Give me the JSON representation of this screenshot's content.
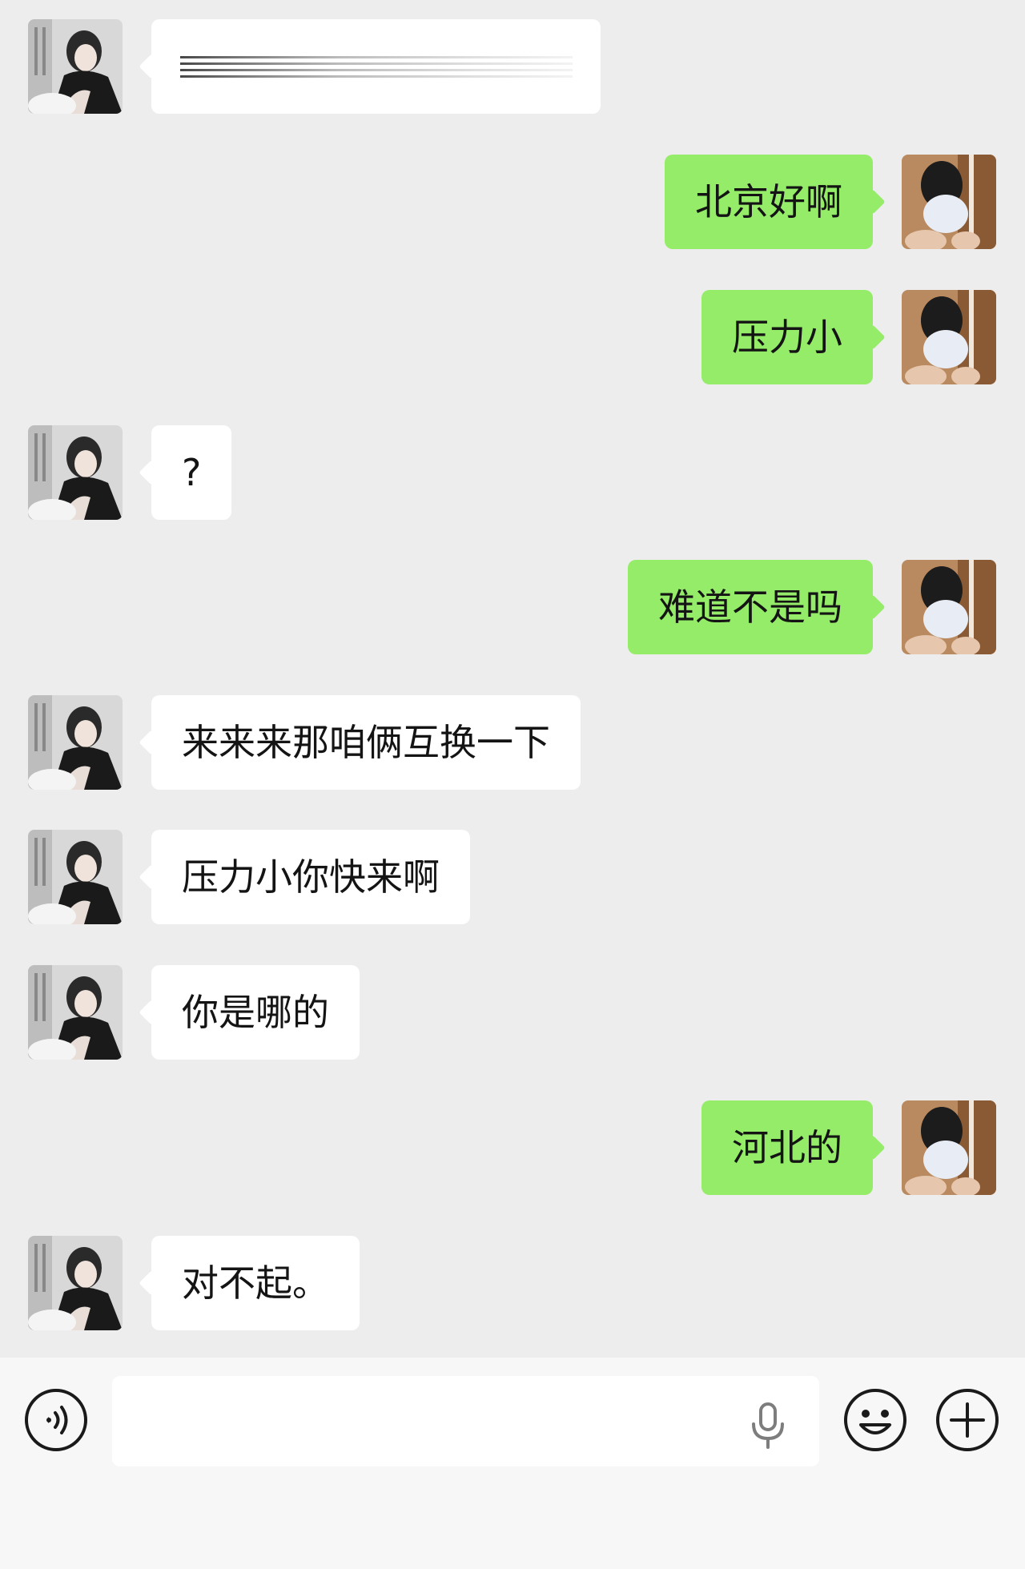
{
  "messages": [
    {
      "side": "left",
      "text": "",
      "blurred": true
    },
    {
      "side": "right",
      "text": "北京好啊"
    },
    {
      "side": "right",
      "text": "压力小"
    },
    {
      "side": "left",
      "text": "?"
    },
    {
      "side": "right",
      "text": "难道不是吗"
    },
    {
      "side": "left",
      "text": "来来来那咱俩互换一下"
    },
    {
      "side": "left",
      "text": "压力小你快来啊"
    },
    {
      "side": "left",
      "text": "你是哪的"
    },
    {
      "side": "right",
      "text": "河北的"
    },
    {
      "side": "left",
      "text": "对不起。"
    }
  ],
  "input_bar": {
    "text_value": "",
    "placeholder": "",
    "icons": [
      "voice-icon",
      "microphone-icon",
      "emoji-icon",
      "plus-icon"
    ]
  },
  "colors": {
    "background": "#ededed",
    "outgoing_bubble": "#95ec69",
    "incoming_bubble": "#ffffff",
    "input_bar": "#f7f7f7"
  }
}
